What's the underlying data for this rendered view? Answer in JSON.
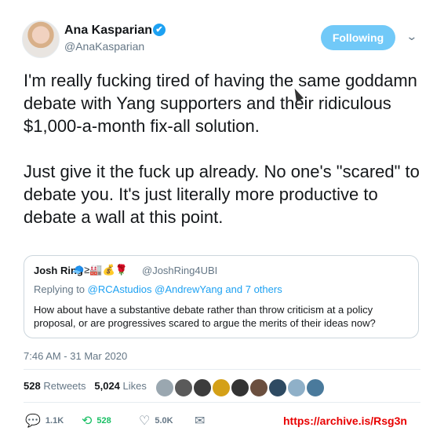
{
  "author": {
    "name": "Ana Kasparian",
    "handle": "@AnaKasparian",
    "verified_icon": "✔",
    "follow_label": "Following",
    "menu_icon": "⌄"
  },
  "tweet_text": "I'm really fucking tired of having the same goddamn debate with Yang supporters and their ridiculous $1,000-a-month fix-all solution.\n\nJust give it the fuck up already. No one's \"scared\" to debate you. It's just literally more productive to debate a wall at this point.",
  "quoted_tweet": {
    "name": "Josh Ring",
    "emoji": "🧢≥🏭💰🌹",
    "handle": "@JoshRing4UBI",
    "replying_prefix": "Replying to",
    "replying_to": "@RCAstudios @AndrewYang",
    "replying_suffix": "and 7 others",
    "body": "How about have a substantive debate rather than throw criticism at a policy proposal, or are progressives scared to argue the merits of their ideas now?"
  },
  "timestamp": "7:46 AM - 31 Mar 2020",
  "stats": {
    "retweets_count": "528",
    "retweets_label": "Retweets",
    "likes_count": "5,024",
    "likes_label": "Likes"
  },
  "likers_colors": [
    "#9aa7b0",
    "#5a5a5a",
    "#3c3c3c",
    "#d4a017",
    "#333333",
    "#6b4f3f",
    "#2e4a62",
    "#8fb0c8",
    "#4a7a9c"
  ],
  "actions": {
    "reply_icon": "💬",
    "reply_count": "1.1K",
    "retweet_icon": "⟲",
    "retweet_count": "528",
    "like_icon": "♡",
    "like_count": "5.0K",
    "dm_icon": "✉"
  },
  "archive_link": "https://archive.is/Rsg3n"
}
